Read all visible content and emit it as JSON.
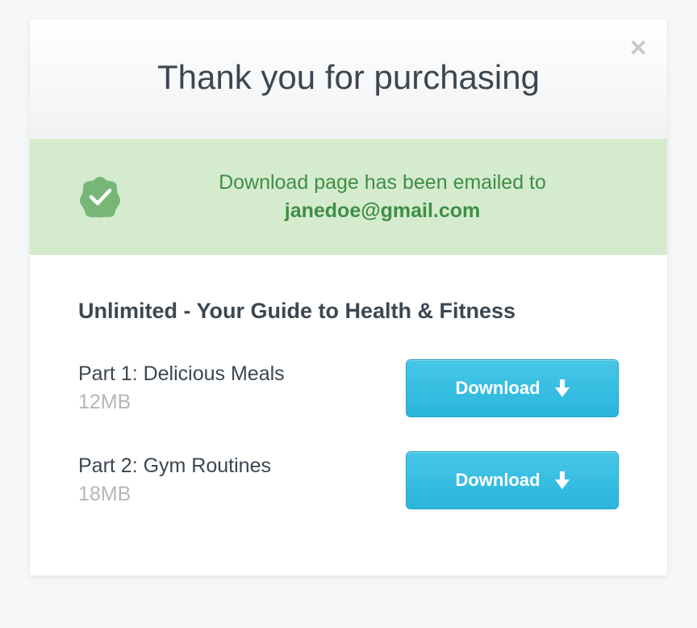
{
  "header": {
    "title": "Thank you for purchasing"
  },
  "notice": {
    "message": "Download page has been emailed to",
    "email": "janedoe@gmail.com"
  },
  "product": {
    "title": "Unlimited - Your Guide to Health & Fitness"
  },
  "files": [
    {
      "name": "Part 1: Delicious Meals",
      "size": "12MB",
      "button_label": "Download"
    },
    {
      "name": "Part 2: Gym Routines",
      "size": "18MB",
      "button_label": "Download"
    }
  ]
}
